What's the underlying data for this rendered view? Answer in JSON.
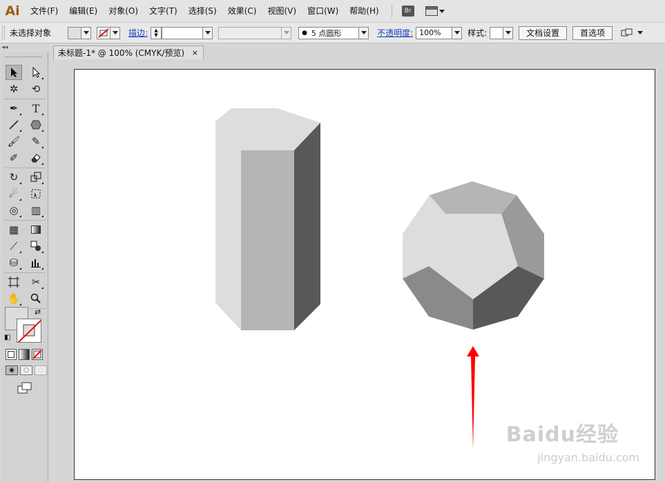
{
  "app": {
    "logo": "Ai",
    "menu": [
      "文件(F)",
      "编辑(E)",
      "对象(O)",
      "文字(T)",
      "选择(S)",
      "效果(C)",
      "视图(V)",
      "窗口(W)",
      "帮助(H)"
    ],
    "bridge_label": "Br"
  },
  "control_bar": {
    "selection_status": "未选择对象",
    "stroke_label": "描边:",
    "brush_label": "5 点圆形",
    "opacity_label": "不透明度:",
    "opacity_value": "100%",
    "style_label": "样式:",
    "doc_setup_button": "文档设置",
    "preferences_button": "首选项"
  },
  "document": {
    "tab_title": "未标题-1* @ 100% (CMYK/预览)",
    "tab_close": "×"
  },
  "colors": {
    "logo": "#9e5a12",
    "arrow": "#ff0000",
    "face_light": "#dcdedd",
    "face_mid": "#b4b5b4",
    "face_dark": "#595758",
    "face_darker": "#8a8a8a"
  },
  "watermark": {
    "main": "Baidu经验",
    "sub": "jingyan.baidu.com"
  }
}
